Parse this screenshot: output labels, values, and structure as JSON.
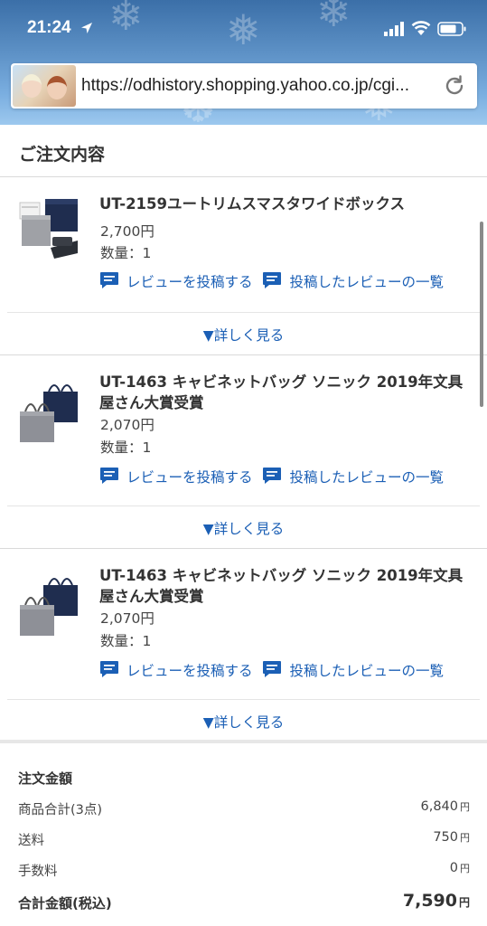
{
  "status_bar": {
    "time": "21:24"
  },
  "browser": {
    "url": "https://odhistory.shopping.yahoo.co.jp/cgi..."
  },
  "order": {
    "section_title": "ご注文内容",
    "items": [
      {
        "name": "UT-2159ユートリムスマスタワイドボックス",
        "price": "2,700円",
        "quantity": "数量：1",
        "review_post_label": "レビューを投稿する",
        "review_list_label": "投稿したレビューの一覧",
        "more_label": "▼詳しく見る"
      },
      {
        "name": "UT-1463 キャビネットバッグ ソニック 2019年文具屋さん大賞受賞",
        "price": "2,070円",
        "quantity": "数量：1",
        "review_post_label": "レビューを投稿する",
        "review_list_label": "投稿したレビューの一覧",
        "more_label": "▼詳しく見る"
      },
      {
        "name": "UT-1463 キャビネットバッグ ソニック 2019年文具屋さん大賞受賞",
        "price": "2,070円",
        "quantity": "数量：1",
        "review_post_label": "レビューを投稿する",
        "review_list_label": "投稿したレビューの一覧",
        "more_label": "▼詳しく見る"
      }
    ]
  },
  "totals": {
    "title": "注文金額",
    "subtotal_label": "商品合計(3点)",
    "subtotal_value": "6,840",
    "shipping_label": "送料",
    "shipping_value": "750",
    "fee_label": "手数料",
    "fee_value": "0",
    "grand_label": "合計金額(税込)",
    "grand_value": "7,590",
    "currency": "円"
  },
  "colors": {
    "link": "#1b5fb5",
    "text": "#333333",
    "divider": "#d9d9d9"
  }
}
